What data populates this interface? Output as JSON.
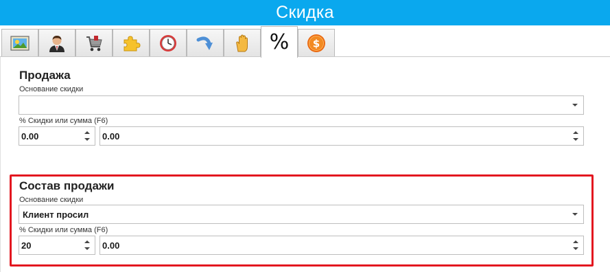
{
  "window": {
    "title": "Скидка"
  },
  "tabs": [
    {
      "icon": "picture-icon"
    },
    {
      "icon": "user-icon"
    },
    {
      "icon": "cart-icon"
    },
    {
      "icon": "puzzle-icon"
    },
    {
      "icon": "clock-icon"
    },
    {
      "icon": "arrow-icon"
    },
    {
      "icon": "hand-icon"
    },
    {
      "icon": "percent-icon",
      "label": "%",
      "active": true
    },
    {
      "icon": "dollar-coin-icon",
      "label": "$"
    }
  ],
  "sale": {
    "title": "Продажа",
    "reason_label": "Основание скидки",
    "reason_value": "",
    "discount_label": "% Скидки или сумма (F6)",
    "percent_value": "0.00",
    "amount_value": "0.00"
  },
  "sale_items": {
    "title": "Состав продажи",
    "reason_label": "Основание скидки",
    "reason_value": "Клиент просил",
    "discount_label": "% Скидки или сумма (F6)",
    "percent_value": "20",
    "amount_value": "0.00"
  },
  "colors": {
    "titlebar": "#0aa8ee",
    "highlight": "#e3161f"
  }
}
